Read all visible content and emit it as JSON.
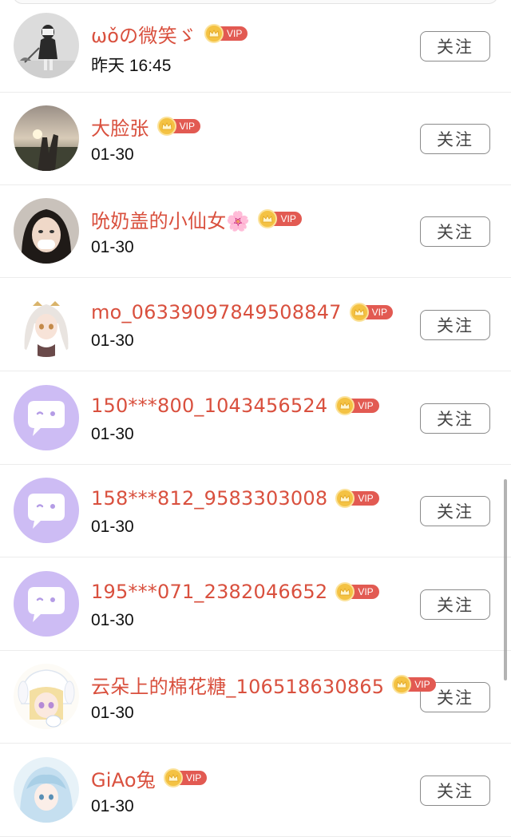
{
  "follow_label": "关注",
  "vip_label": "VIP",
  "colors": {
    "name": "#d9503e",
    "vip_tag": "#e25a52",
    "crown": "#f4c243",
    "default_avatar_bg": "#cdbcf4"
  },
  "users": [
    {
      "name": "ωǒの微笑ゞ",
      "date": "昨天 16:45",
      "avatar": "photo-girl-umbrella"
    },
    {
      "name": "大脸张",
      "date": "01-30",
      "avatar": "photo-sunset-hand"
    },
    {
      "name": "吮奶盖的小仙女🌸",
      "date": "01-30",
      "avatar": "photo-girl-face"
    },
    {
      "name": "mo_06339097849508847",
      "date": "01-30",
      "avatar": "anime-girl-white-hair"
    },
    {
      "name": "150***800_1043456524",
      "date": "01-30",
      "avatar": "default-chat-bubble-icon"
    },
    {
      "name": "158***812_9583303008",
      "date": "01-30",
      "avatar": "default-chat-bubble-icon"
    },
    {
      "name": "195***071_2382046652",
      "date": "01-30",
      "avatar": "default-chat-bubble-icon"
    },
    {
      "name": "云朵上的棉花糖_106518630865",
      "date": "01-30",
      "avatar": "anime-girl-cinnamoroll"
    },
    {
      "name": "GiAo兔",
      "date": "01-30",
      "avatar": "anime-girl-blue-hair"
    }
  ]
}
